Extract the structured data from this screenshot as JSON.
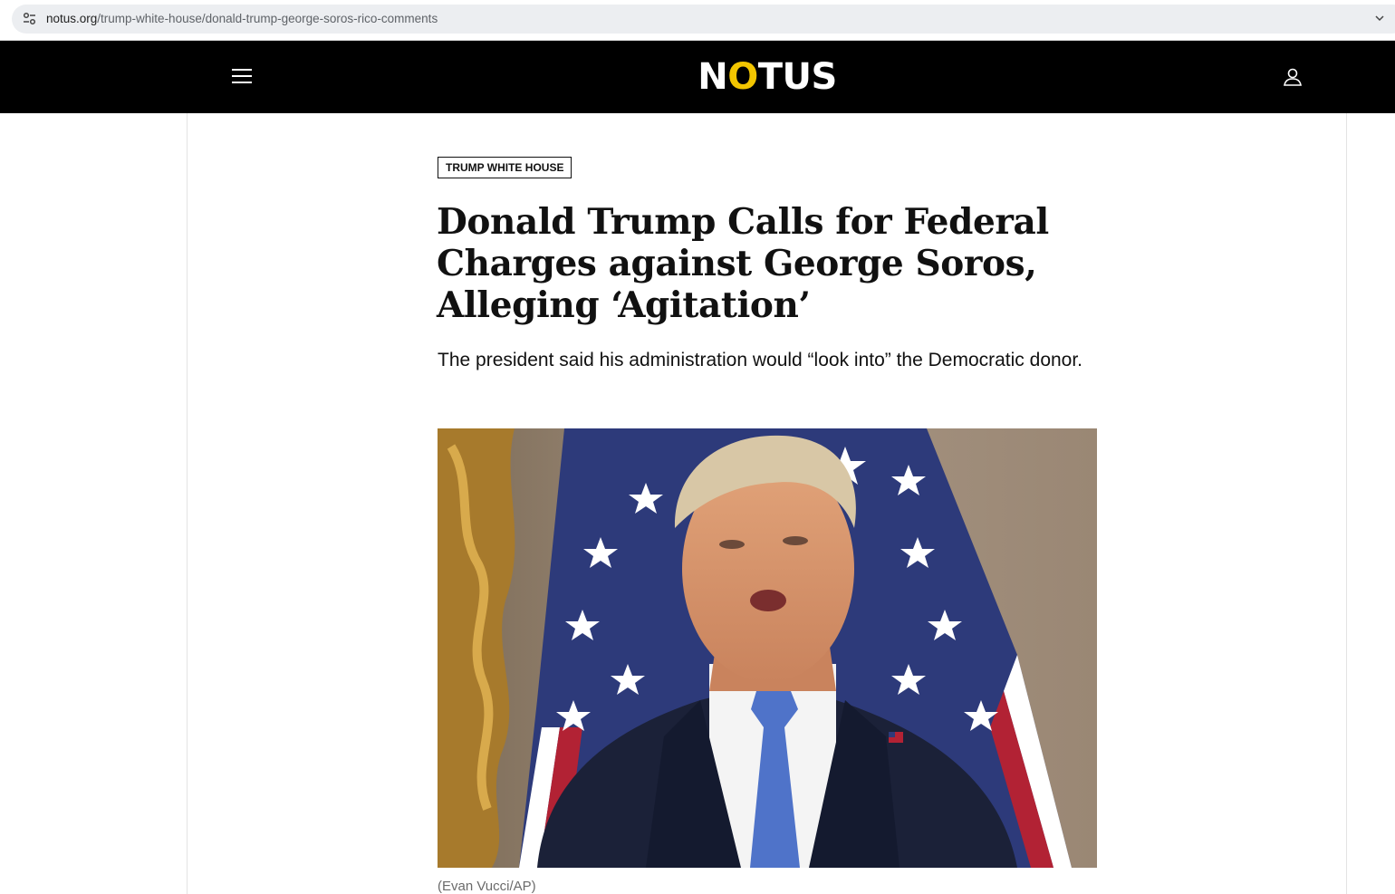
{
  "browser": {
    "url_host": "notus.org",
    "url_path": "/trump-white-house/donald-trump-george-soros-rico-comments"
  },
  "header": {
    "logo_prefix": "N",
    "logo_o": "O",
    "logo_suffix": "TUS",
    "accent_color": "#f2c500"
  },
  "article": {
    "category": "TRUMP WHITE HOUSE",
    "headline": "Donald Trump Calls for Federal Charges against George Soros, Alleging ‘Agitation’",
    "dek": "The president said his administration would “look into” the Democratic donor.",
    "photo_credit": "(Evan Vucci/AP)"
  },
  "icons": {
    "menu": "hamburger-menu-icon",
    "account": "user-icon",
    "site_info": "tune-icon",
    "url_dropdown": "chevron-down-icon"
  }
}
